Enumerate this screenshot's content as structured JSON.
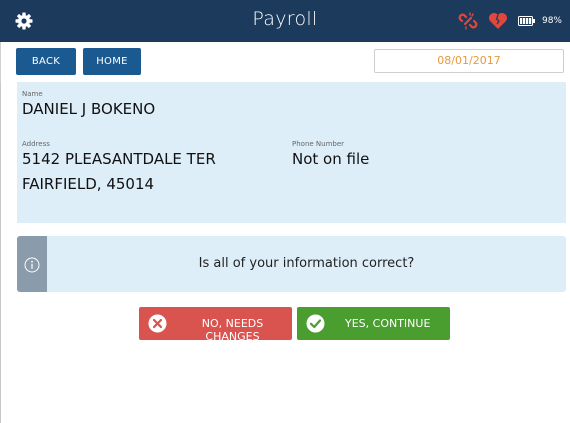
{
  "header": {
    "title": "Payroll",
    "battery_percent": "98%",
    "colors": {
      "bar": "#1b3a5c",
      "link_broken": "#e0483d",
      "heart": "#e0483d"
    }
  },
  "toolbar": {
    "back_label": "BACK",
    "home_label": "HOME",
    "date": "08/01/2017"
  },
  "employee": {
    "name_label": "Name",
    "name": "DANIEL J BOKENO",
    "address_label": "Address",
    "address_line1": "5142 PLEASANTDALE TER",
    "address_line2": "FAIRFIELD, 45014",
    "phone_label": "Phone Number",
    "phone": "Not on file"
  },
  "notice": {
    "icon": "info-icon",
    "question": "Is all of your information correct?"
  },
  "actions": {
    "no_label": "NO, NEEDS CHANGES",
    "yes_label": "YES, CONTINUE",
    "no_color": "#d9534f",
    "yes_color": "#4a9e2f"
  }
}
